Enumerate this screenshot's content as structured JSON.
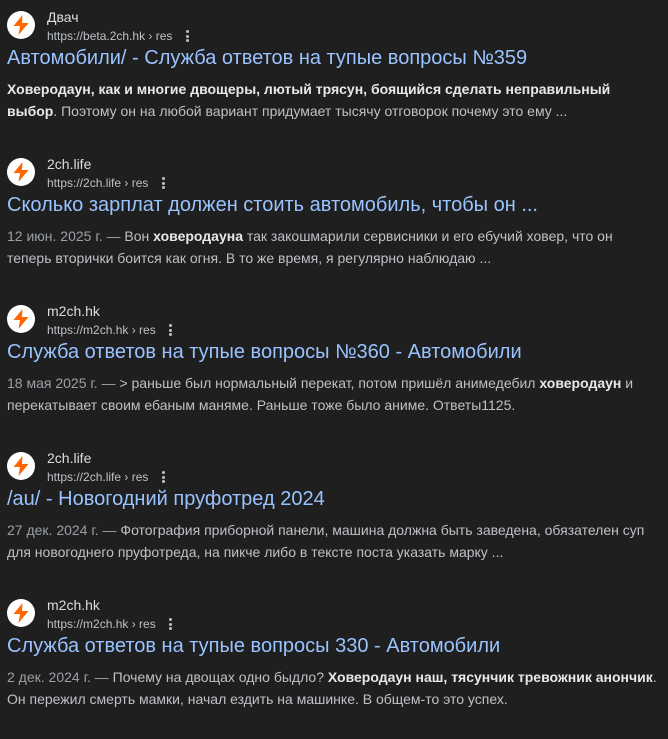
{
  "results": [
    {
      "site_name": "Двач",
      "url": "https://beta.2ch.hk › res",
      "title": "Автомобили/ - Служба ответов на тупые вопросы №359",
      "date": "",
      "snippet_parts": [
        {
          "bold": true,
          "text": "Ховеродаун, как и многие двощеры, лютый трясун, боящийся сделать неправильный выбор"
        },
        {
          "bold": false,
          "text": ". Поэтому он на любой вариант придумает тысячу отговорок почему это ему ..."
        }
      ]
    },
    {
      "site_name": "2ch.life",
      "url": "https://2ch.life › res",
      "title": "Сколько зарплат должен стоить автомобиль, чтобы он ...",
      "date": "12 июн. 2025 г. — ",
      "snippet_parts": [
        {
          "bold": false,
          "text": "Вон "
        },
        {
          "bold": true,
          "text": "ховеродауна"
        },
        {
          "bold": false,
          "text": " так закошмарили сервисники и его ебучий ховер, что он теперь вторички боится как огня. В то же время, я регулярно наблюдаю ..."
        }
      ]
    },
    {
      "site_name": "m2ch.hk",
      "url": "https://m2ch.hk › res",
      "title": "Служба ответов на тупые вопросы №360 - Автомобили",
      "date": "18 мая 2025 г. — ",
      "snippet_parts": [
        {
          "bold": false,
          "text": "> раньше был нормальный перекат, потом пришёл анимедебил "
        },
        {
          "bold": true,
          "text": "ховеродаун"
        },
        {
          "bold": false,
          "text": " и перекатывает своим ебаным маняме. Раньше тоже было аниме. Ответы1125."
        }
      ]
    },
    {
      "site_name": "2ch.life",
      "url": "https://2ch.life › res",
      "title": "/au/ - Новогодний пруфотред 2024",
      "date": "27 дек. 2024 г. — ",
      "snippet_parts": [
        {
          "bold": false,
          "text": "Фотография приборной панели, машина должна быть заведена, обязателен суп для новогоднего пруфотреда, на пикче либо в тексте поста указать марку ..."
        }
      ]
    },
    {
      "site_name": "m2ch.hk",
      "url": "https://m2ch.hk › res",
      "title": "Служба ответов на тупые вопросы 330 - Автомобили",
      "date": "2 дек. 2024 г. — ",
      "snippet_parts": [
        {
          "bold": false,
          "text": "Почему на двощах одно быдло? "
        },
        {
          "bold": true,
          "text": "Ховеродаун наш, тясунчик тревожник анончик"
        },
        {
          "bold": false,
          "text": ". Он пережил смерть мамки, начал ездить на машинке. В общем-то это успех."
        }
      ]
    }
  ],
  "colors": {
    "background": "#1f1f1f",
    "title_link": "#99c3ff",
    "site_name": "#dadce0",
    "snippet_text": "#bdc1c6",
    "snippet_bold": "#e8e8e8",
    "favicon_bolt": "#ff6600",
    "favicon_bg": "#ffffff"
  },
  "icons": {
    "favicon": "lightning-bolt-icon",
    "more": "vertical-dots-icon"
  }
}
